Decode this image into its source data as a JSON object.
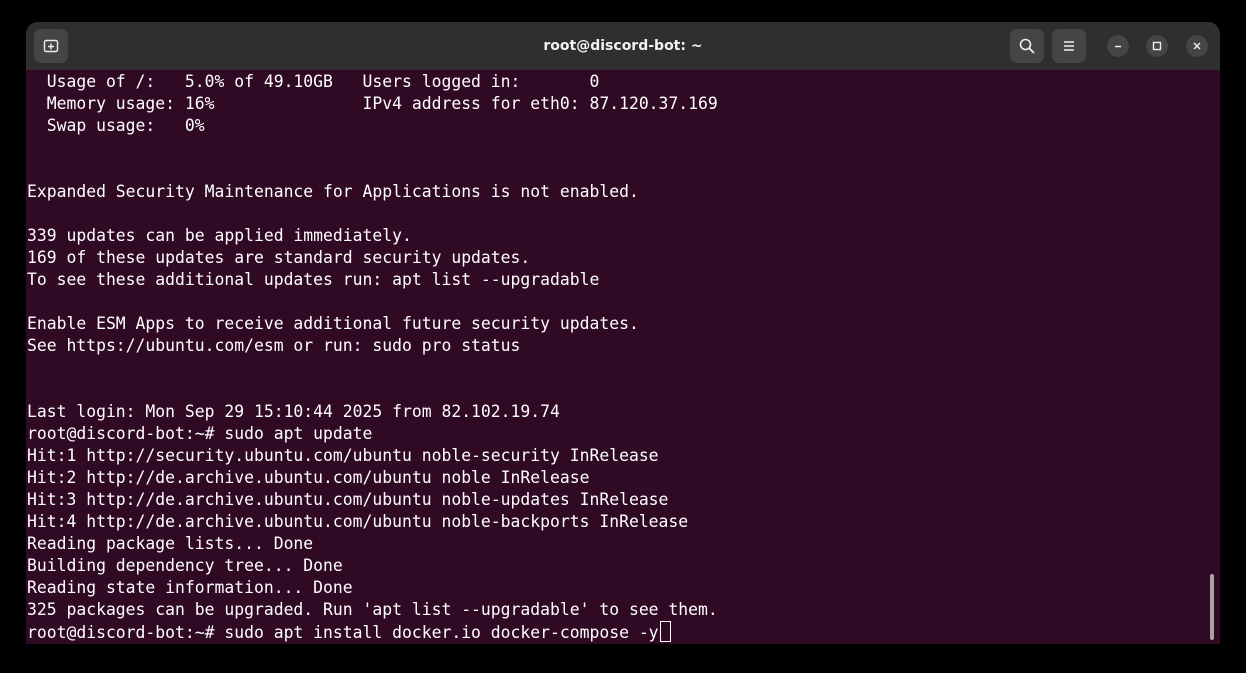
{
  "window": {
    "title": "root@discord-bot: ~"
  },
  "toolbar": {
    "new_tab_icon": "new-tab-icon",
    "search_icon": "search-icon",
    "menu_icon": "hamburger-menu-icon",
    "minimize_icon": "minimize-icon",
    "maximize_icon": "maximize-icon",
    "close_icon": "close-icon"
  },
  "terminal": {
    "lines": [
      "  Usage of /:   5.0% of 49.10GB   Users logged in:       0",
      "  Memory usage: 16%               IPv4 address for eth0: 87.120.37.169",
      "  Swap usage:   0%",
      "",
      "",
      "Expanded Security Maintenance for Applications is not enabled.",
      "",
      "339 updates can be applied immediately.",
      "169 of these updates are standard security updates.",
      "To see these additional updates run: apt list --upgradable",
      "",
      "Enable ESM Apps to receive additional future security updates.",
      "See https://ubuntu.com/esm or run: sudo pro status",
      "",
      "",
      "Last login: Mon Sep 29 15:10:44 2025 from 82.102.19.74",
      "root@discord-bot:~# sudo apt update",
      "Hit:1 http://security.ubuntu.com/ubuntu noble-security InRelease",
      "Hit:2 http://de.archive.ubuntu.com/ubuntu noble InRelease",
      "Hit:3 http://de.archive.ubuntu.com/ubuntu noble-updates InRelease",
      "Hit:4 http://de.archive.ubuntu.com/ubuntu noble-backports InRelease",
      "Reading package lists... Done",
      "Building dependency tree... Done",
      "Reading state information... Done",
      "325 packages can be upgraded. Run 'apt list --upgradable' to see them."
    ],
    "prompt_line": "root@discord-bot:~# sudo apt install docker.io docker-compose -y"
  },
  "colors": {
    "terminal_background": "#300a24",
    "titlebar_background": "#2f2f2f",
    "text": "#ffffff"
  }
}
